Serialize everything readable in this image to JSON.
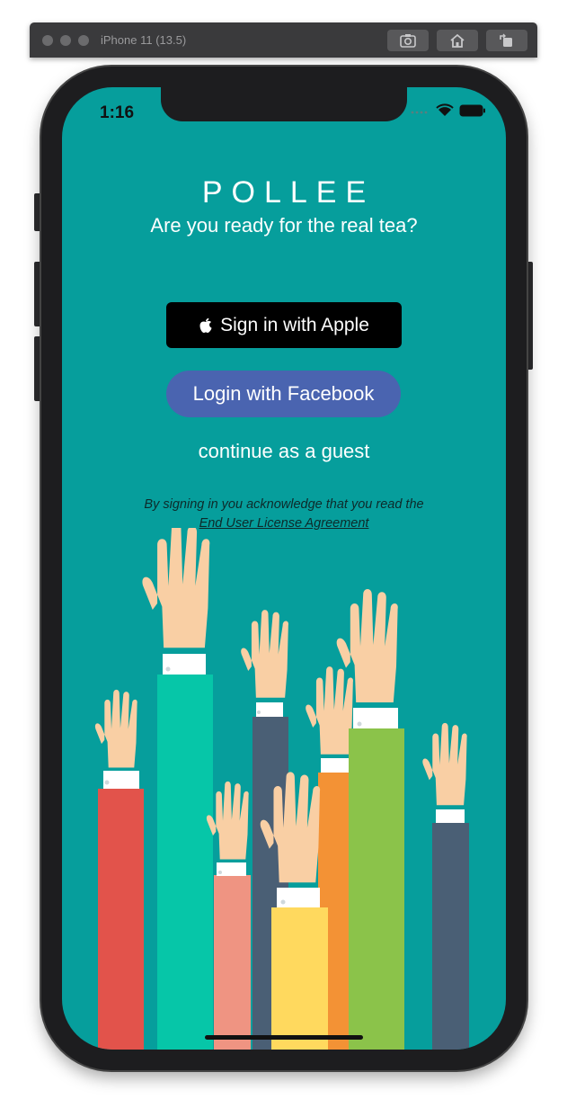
{
  "simulator": {
    "device_title": "iPhone 11 (13.5)",
    "toolbar_icons": [
      "screenshot-icon",
      "home-icon",
      "rotate-icon"
    ]
  },
  "status_bar": {
    "time": "1:16",
    "icons": [
      "cellular-icon",
      "wifi-icon",
      "battery-icon"
    ]
  },
  "app": {
    "title": "POLLEE",
    "tagline": "Are you ready for the real tea?",
    "apple_button_label": "Sign in with Apple",
    "facebook_button_label": "Login with Facebook",
    "guest_link": "continue as a guest",
    "legal_text": "By signing in you acknowledge that you read the",
    "eula_link": "End User License Agreement"
  },
  "colors": {
    "screen_background": "#069e9c",
    "facebook_button": "#4a64b0",
    "apple_button": "#000000",
    "sleeve_colors": [
      "#e2534b",
      "#06c6a8",
      "#4a5f75",
      "#ef9482",
      "#f39235",
      "#ffd95e",
      "#8bc34a",
      "#4a5f75"
    ],
    "skin": "#f9cfa4"
  },
  "illustration": {
    "icon": "raised-hands-illustration-icon"
  }
}
